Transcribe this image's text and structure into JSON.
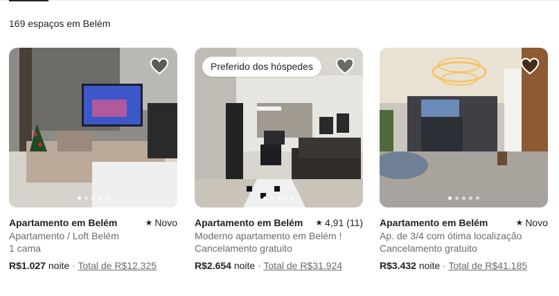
{
  "results_count": "169 espaços em Belém",
  "listings": [
    {
      "title": "Apartamento em Belém",
      "rating_text": "Novo",
      "line2": "Apartamento / Loft Belém",
      "line3": "1 cama",
      "price": "R$1.027",
      "price_unit": "noite",
      "separator": "·",
      "total": "Total de R$12.325"
    },
    {
      "badge": "Preferido dos hóspedes",
      "title": "Apartamento em Belém",
      "rating_text": "4,91 (11)",
      "line2": "Moderno apartamento em Belém !",
      "line3": "Cancelamento gratuito",
      "price": "R$2.654",
      "price_unit": "noite",
      "separator": "·",
      "total": "Total de R$31.924"
    },
    {
      "title": "Apartamento em Belém",
      "rating_text": "Novo",
      "line2": "Ap. de 3/4 com ótima localização",
      "line3": "Cancelamento gratuito",
      "price": "R$3.432",
      "price_unit": "noite",
      "separator": "·",
      "total": "Total de R$41.185"
    }
  ],
  "icons": {
    "favorite": "heart-icon",
    "rating": "star-icon"
  },
  "star_glyph": "★"
}
